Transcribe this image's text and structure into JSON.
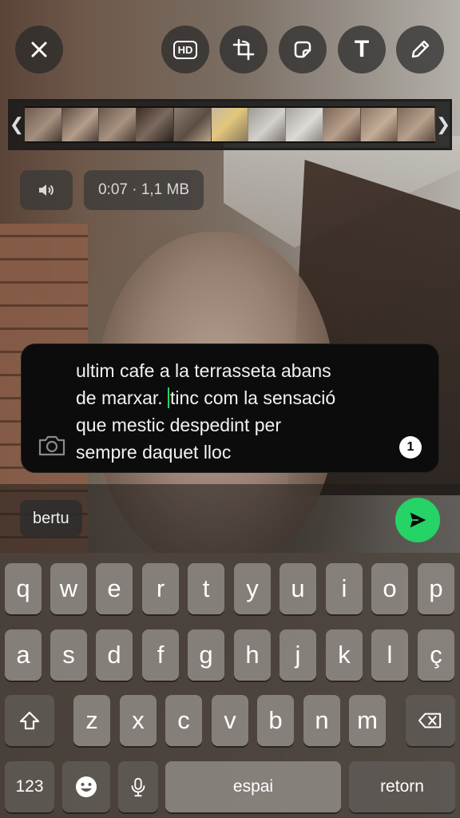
{
  "toolbar": {
    "close_icon": "close-icon",
    "hd_label": "HD",
    "crop_icon": "crop-rotate-icon",
    "sticker_icon": "sticker-icon",
    "text_label": "T",
    "draw_icon": "pencil-icon"
  },
  "video": {
    "mute_icon": "speaker-icon",
    "info": "0:07 · 1,1 MB"
  },
  "caption": {
    "lines_before_cursor": [
      "ultim cafe a la terrasseta abans",
      "de marxar. "
    ],
    "line2_after_cursor": "tinc com la sensació",
    "lines_after": [
      "que mestic despedint per",
      "sempre daquet lloc"
    ],
    "view_once_count": "1"
  },
  "recipient": {
    "name": "bertu"
  },
  "keyboard": {
    "row1": [
      "q",
      "w",
      "e",
      "r",
      "t",
      "y",
      "u",
      "i",
      "o",
      "p"
    ],
    "row2": [
      "a",
      "s",
      "d",
      "f",
      "g",
      "h",
      "j",
      "k",
      "l",
      "ç"
    ],
    "row3": [
      "z",
      "x",
      "c",
      "v",
      "b",
      "n",
      "m"
    ],
    "numbers_label": "123",
    "space_label": "espai",
    "return_label": "retorn"
  },
  "colors": {
    "accent": "#25d366"
  }
}
